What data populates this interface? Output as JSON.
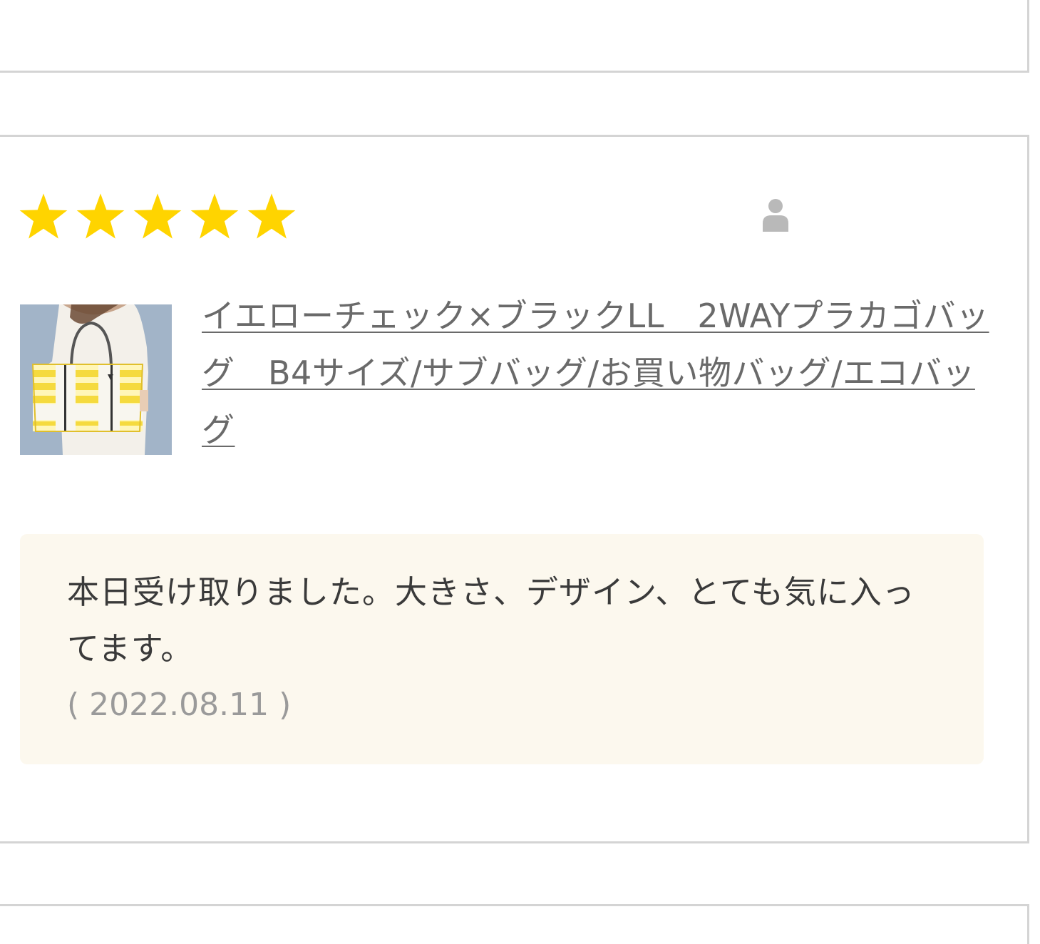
{
  "review": {
    "rating": 5,
    "rating_max": 5,
    "reviewer_name": "",
    "product_title": "イエローチェック×ブラックLL　2WAYプラカゴバッグ　B4サイズ/サブバッグ/お買い物バッグ/エコバッグ",
    "body": "本日受け取りました。大きさ、デザイン、とても気に入ってます。",
    "date": "( 2022.08.11 )"
  },
  "icons": {
    "star": "star-icon",
    "reviewer": "person-icon"
  },
  "colors": {
    "star": "#ffd400",
    "link": "#6a6a6a",
    "review_bg": "#fcf8ee",
    "card_border": "#d4d4d4",
    "date": "#9a9a9a"
  }
}
